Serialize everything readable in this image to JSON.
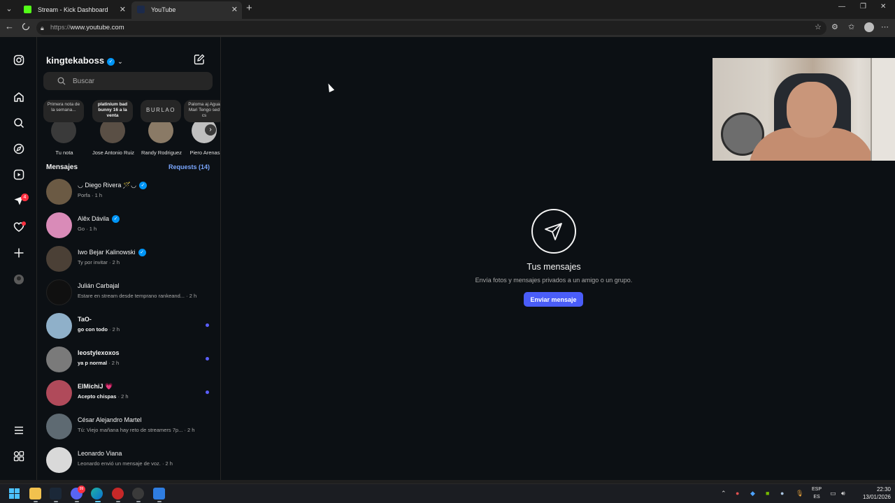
{
  "browser": {
    "tabs": [
      {
        "title": "Stream - Kick Dashboard",
        "favicon_color": "#53fc18"
      },
      {
        "title": "YouTube",
        "favicon_color": "#1c2a4a"
      }
    ],
    "url_protocol": "https://",
    "url_host": "www.youtube.com"
  },
  "inbox": {
    "username": "kingtekaboss",
    "search_placeholder": "Buscar",
    "notes": [
      {
        "bubble": "Primera nota de la semana...",
        "name": "Tu nota",
        "color": "#3a3a3a"
      },
      {
        "bubble": "platinium bad bunny 16 a la venta",
        "name": "Jose Antonio Ruiz",
        "color": "#5a4f45"
      },
      {
        "bubble": "BURLAO",
        "name": "Randy Rodriguez",
        "color": "#8a7a66"
      },
      {
        "bubble": "Paloma aj Agua Mari Tengo sed cs",
        "name": "Piero Arenas",
        "color": "#bfbfbf"
      }
    ],
    "section_title": "Mensajes",
    "requests_label": "Requests (14)",
    "threads": [
      {
        "name": "◡ Diego Rivera 🪄◡",
        "message": "Porfa",
        "time": "· 1 h",
        "verified": true,
        "unread": false,
        "color": "#6b5a44"
      },
      {
        "name": "Alêx Dávila",
        "message": "Go",
        "time": "· 1 h",
        "verified": true,
        "unread": false,
        "color": "#d98bb8"
      },
      {
        "name": "Iwo Bejar Kalinowski",
        "message": "Ty por invitar",
        "time": "· 2 h",
        "verified": true,
        "unread": false,
        "color": "#4b4036"
      },
      {
        "name": "Julián Carbajal",
        "message": "Estare en stream desde temprano rankeand...",
        "time": "· 2 h",
        "verified": false,
        "unread": false,
        "color": "#101010"
      },
      {
        "name": "TaO-",
        "message": "go con todo",
        "time": "· 2 h",
        "verified": false,
        "unread": true,
        "color": "#8fb0c9"
      },
      {
        "name": "leostylexoxos",
        "message": "ya p normal",
        "time": "· 2 h",
        "verified": false,
        "unread": true,
        "color": "#7a7a7a"
      },
      {
        "name": "ElMichiJ 💗",
        "message": "Acepto chispas",
        "time": "· 2 h",
        "verified": false,
        "unread": true,
        "color": "#b04a5a"
      },
      {
        "name": "César Alejandro Martel",
        "message": "Tú: Viejo mañana hay reto de streamers 7p...",
        "time": "· 2 h",
        "verified": false,
        "unread": false,
        "color": "#5e6a72"
      },
      {
        "name": "Leonardo Viana",
        "message": "Leonardo envió un mensaje de voz.",
        "time": "· 2 h",
        "verified": false,
        "unread": false,
        "color": "#d9d9d9"
      }
    ]
  },
  "main": {
    "title": "Tus mensajes",
    "subtitle": "Envía fotos y mensajes privados a un amigo o un grupo.",
    "button": "Enviar mensaje"
  },
  "rail": {
    "notifications_badge": "4"
  },
  "taskbar": {
    "lang_top": "ESP",
    "lang_bottom": "ES",
    "time": "22:30",
    "date": "13/01/2026",
    "discord_badge": "99"
  }
}
